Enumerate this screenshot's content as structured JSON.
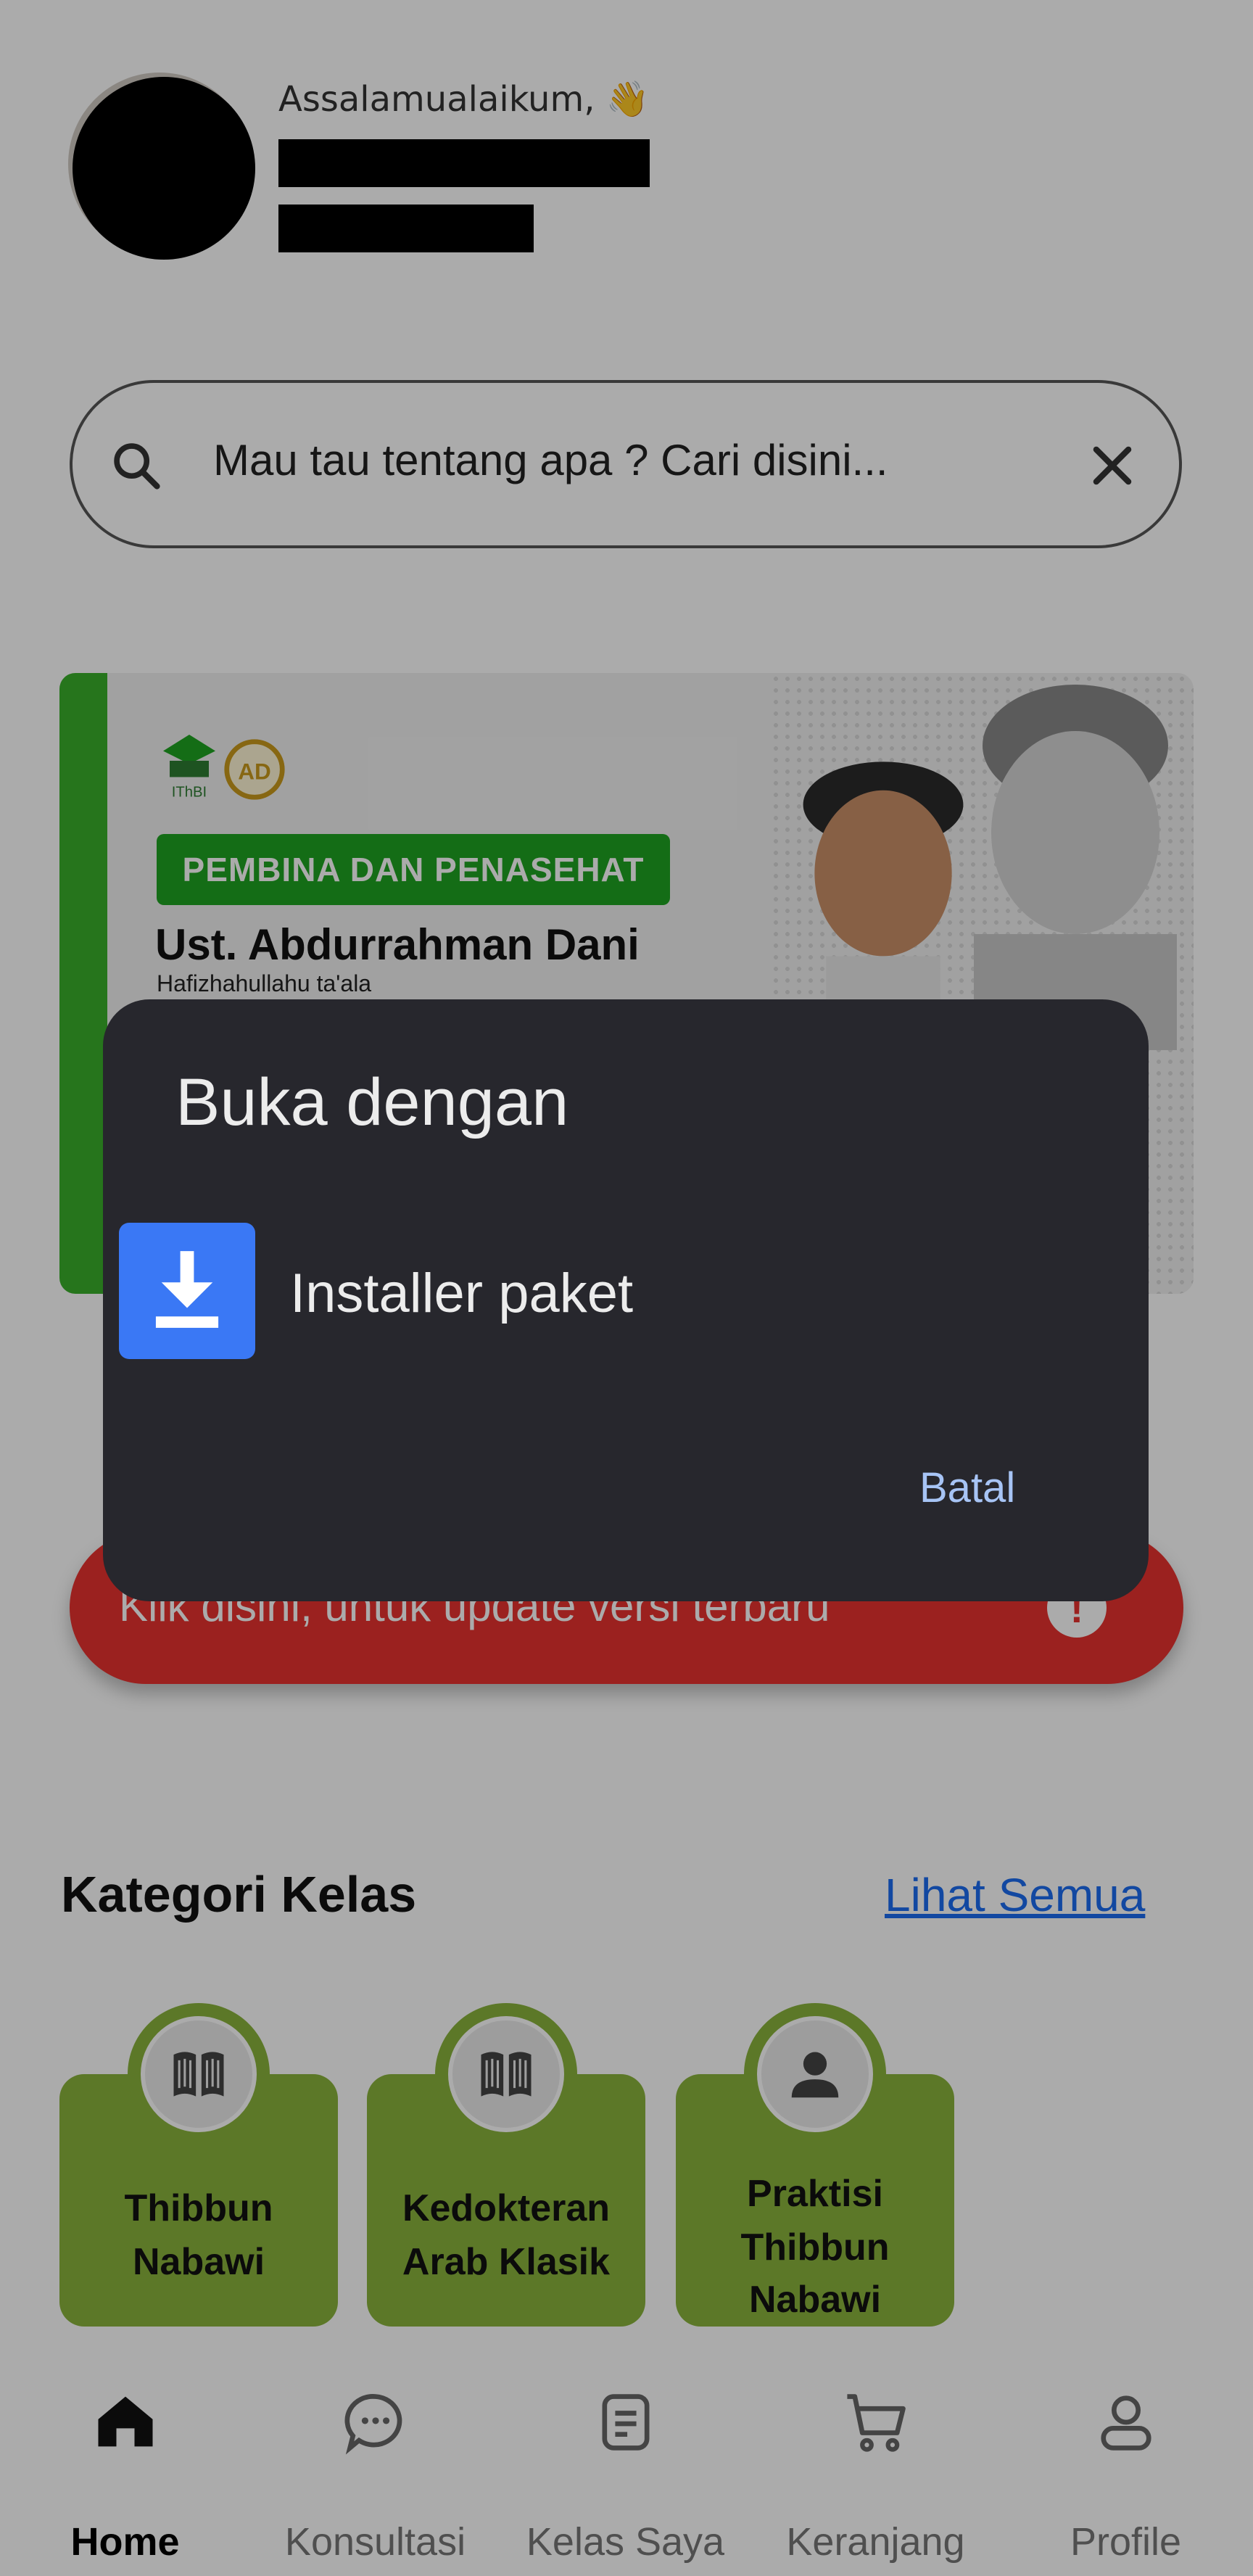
{
  "header": {
    "greeting": "Assalamualaikum,",
    "wave_emoji": "👋"
  },
  "search": {
    "placeholder": "Mau tau tentang apa ? Cari disini...",
    "icon": "search-icon",
    "clear_icon": "close-icon"
  },
  "banner": {
    "badge": "PEMBINA DAN PENASEHAT",
    "name": "Ust. Abdurrahman Dani",
    "subtitle": "Hafizhahullahu ta'ala",
    "logo_left": "IThBI"
  },
  "update_button": {
    "label": "Klik disini, untuk update versi terbaru",
    "icon": "!"
  },
  "kategori": {
    "title": "Kategori Kelas",
    "see_all": "Lihat Semua",
    "items": [
      {
        "line1": "Thibbun",
        "line2": "Nabawi",
        "line3": "",
        "icon": "book-icon"
      },
      {
        "line1": "Kedokteran",
        "line2": "Arab Klasik",
        "line3": "",
        "icon": "book-icon"
      },
      {
        "line1": "Praktisi",
        "line2": "Thibbun",
        "line3": "Nabawi",
        "icon": "person-icon"
      }
    ]
  },
  "nav": {
    "items": [
      {
        "label": "Home",
        "icon": "home-icon",
        "active": true
      },
      {
        "label": "Konsultasi",
        "icon": "chat-icon",
        "active": false
      },
      {
        "label": "Kelas Saya",
        "icon": "document-icon",
        "active": false
      },
      {
        "label": "Keranjang",
        "icon": "cart-icon",
        "active": false
      },
      {
        "label": "Profile",
        "icon": "profile-icon",
        "active": false
      }
    ]
  },
  "dialog": {
    "title": "Buka dengan",
    "option_label": "Installer paket",
    "option_icon": "download-icon",
    "cancel_label": "Batal"
  },
  "colors": {
    "accent_green": "#1fa321",
    "card_green": "#8ab43c",
    "update_red": "#e8322f",
    "link_blue": "#1b6cf0",
    "dialog_bg": "#27272d",
    "installer_blue": "#3a78f5"
  }
}
